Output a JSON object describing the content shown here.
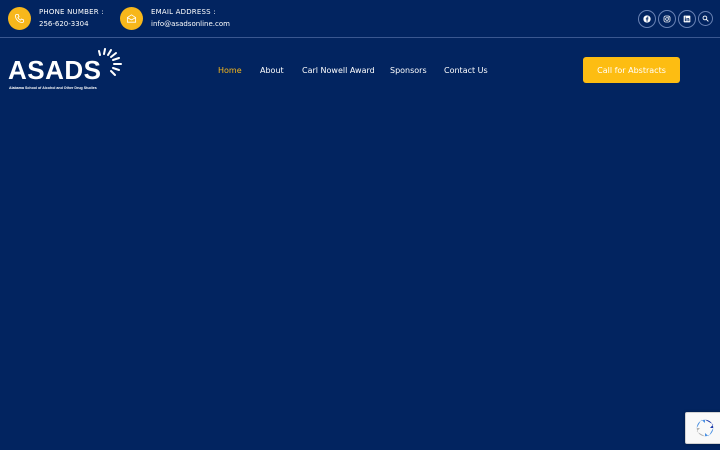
{
  "topbar": {
    "phone": {
      "label": "PHONE NUMBER :",
      "value": "256-620-3304",
      "icon": "phone-icon"
    },
    "email": {
      "label": "EMAIL ADDRESS :",
      "value": "info@asadsonline.com",
      "icon": "envelope-icon"
    },
    "social": [
      "facebook-icon",
      "instagram-icon",
      "linkedin-icon",
      "search-icon"
    ]
  },
  "logo": {
    "wordmark": "ASADS",
    "tagline": "Alabama School of Alcohol and Other Drug Studies"
  },
  "nav": {
    "items": [
      {
        "label": "Home",
        "active": true
      },
      {
        "label": "About",
        "active": false
      },
      {
        "label": "Carl Nowell Award",
        "active": false
      },
      {
        "label": "Sponsors",
        "active": false
      },
      {
        "label": "Contact Us",
        "active": false
      }
    ]
  },
  "cta": {
    "label": "Call for Abstracts"
  },
  "colors": {
    "background": "#022460",
    "accent": "#f7b71b",
    "button": "#fdbd12"
  }
}
